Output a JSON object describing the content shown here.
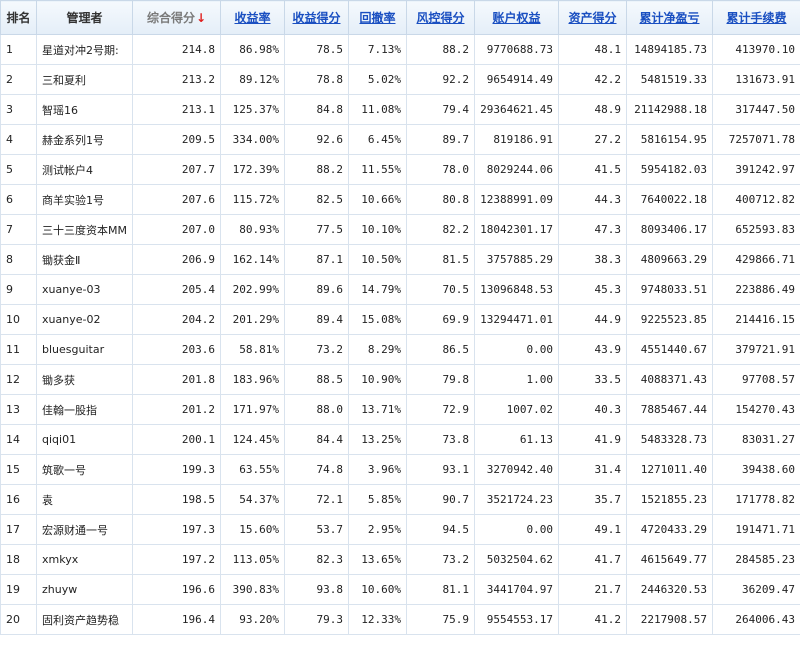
{
  "columns": [
    {
      "label": "排名",
      "link": false
    },
    {
      "label": "管理者",
      "link": false
    },
    {
      "label": "综合得分",
      "link": false,
      "active": true,
      "sort_arrow": "↓"
    },
    {
      "label": "收益率",
      "link": true
    },
    {
      "label": "收益得分",
      "link": true
    },
    {
      "label": "回撤率",
      "link": true
    },
    {
      "label": "风控得分",
      "link": true
    },
    {
      "label": "账户权益",
      "link": true
    },
    {
      "label": "资产得分",
      "link": true
    },
    {
      "label": "累计净盈亏",
      "link": true
    },
    {
      "label": "累计手续费",
      "link": true
    }
  ],
  "colors": {
    "link": "#1a4fc1",
    "profit": "#d40000",
    "sort_arrow": "#e02020"
  },
  "rows": [
    [
      "1",
      "星道对冲2号期:",
      "214.8",
      "86.98%",
      "78.5",
      "7.13%",
      "88.2",
      "9770688.73",
      "48.1",
      "14894185.73",
      "413970.10"
    ],
    [
      "2",
      "三和夏利",
      "213.2",
      "89.12%",
      "78.8",
      "5.02%",
      "92.2",
      "9654914.49",
      "42.2",
      "5481519.33",
      "131673.91"
    ],
    [
      "3",
      "智瑶16",
      "213.1",
      "125.37%",
      "84.8",
      "11.08%",
      "79.4",
      "29364621.45",
      "48.9",
      "21142988.18",
      "317447.50"
    ],
    [
      "4",
      "赫金系列1号",
      "209.5",
      "334.00%",
      "92.6",
      "6.45%",
      "89.7",
      "819186.91",
      "27.2",
      "5816154.95",
      "7257071.78"
    ],
    [
      "5",
      "测试帐户4",
      "207.7",
      "172.39%",
      "88.2",
      "11.55%",
      "78.0",
      "8029244.06",
      "41.5",
      "5954182.03",
      "391242.97"
    ],
    [
      "6",
      "商羊实验1号",
      "207.6",
      "115.72%",
      "82.5",
      "10.66%",
      "80.8",
      "12388991.09",
      "44.3",
      "7640022.18",
      "400712.82"
    ],
    [
      "7",
      "三十三度资本MM",
      "207.0",
      "80.93%",
      "77.5",
      "10.10%",
      "82.2",
      "18042301.17",
      "47.3",
      "8093406.17",
      "652593.83"
    ],
    [
      "8",
      "锄获金Ⅱ",
      "206.9",
      "162.14%",
      "87.1",
      "10.50%",
      "81.5",
      "3757885.29",
      "38.3",
      "4809663.29",
      "429866.71"
    ],
    [
      "9",
      "xuanye-03",
      "205.4",
      "202.99%",
      "89.6",
      "14.79%",
      "70.5",
      "13096848.53",
      "45.3",
      "9748033.51",
      "223886.49"
    ],
    [
      "10",
      "xuanye-02",
      "204.2",
      "201.29%",
      "89.4",
      "15.08%",
      "69.9",
      "13294471.01",
      "44.9",
      "9225523.85",
      "214416.15"
    ],
    [
      "11",
      "bluesguitar",
      "203.6",
      "58.81%",
      "73.2",
      "8.29%",
      "86.5",
      "0.00",
      "43.9",
      "4551440.67",
      "379721.91"
    ],
    [
      "12",
      "锄多获",
      "201.8",
      "183.96%",
      "88.5",
      "10.90%",
      "79.8",
      "1.00",
      "33.5",
      "4088371.43",
      "97708.57"
    ],
    [
      "13",
      "佳翰一股指",
      "201.2",
      "171.97%",
      "88.0",
      "13.71%",
      "72.9",
      "1007.02",
      "40.3",
      "7885467.44",
      "154270.43"
    ],
    [
      "14",
      "qiqi01",
      "200.1",
      "124.45%",
      "84.4",
      "13.25%",
      "73.8",
      "61.13",
      "41.9",
      "5483328.73",
      "83031.27"
    ],
    [
      "15",
      "筑歌一号",
      "199.3",
      "63.55%",
      "74.8",
      "3.96%",
      "93.1",
      "3270942.40",
      "31.4",
      "1271011.40",
      "39438.60"
    ],
    [
      "16",
      "袁",
      "198.5",
      "54.37%",
      "72.1",
      "5.85%",
      "90.7",
      "3521724.23",
      "35.7",
      "1521855.23",
      "171778.82"
    ],
    [
      "17",
      "宏源财通一号",
      "197.3",
      "15.60%",
      "53.7",
      "2.95%",
      "94.5",
      "0.00",
      "49.1",
      "4720433.29",
      "191471.71"
    ],
    [
      "18",
      "xmkyx",
      "197.2",
      "113.05%",
      "82.3",
      "13.65%",
      "73.2",
      "5032504.62",
      "41.7",
      "4615649.77",
      "284585.23"
    ],
    [
      "19",
      "zhuyw",
      "196.6",
      "390.83%",
      "93.8",
      "10.60%",
      "81.1",
      "3441704.97",
      "21.7",
      "2446320.53",
      "36209.47"
    ],
    [
      "20",
      "固利资产趋势稳",
      "196.4",
      "93.20%",
      "79.3",
      "12.33%",
      "75.9",
      "9554553.17",
      "41.2",
      "2217908.57",
      "264006.43"
    ]
  ]
}
